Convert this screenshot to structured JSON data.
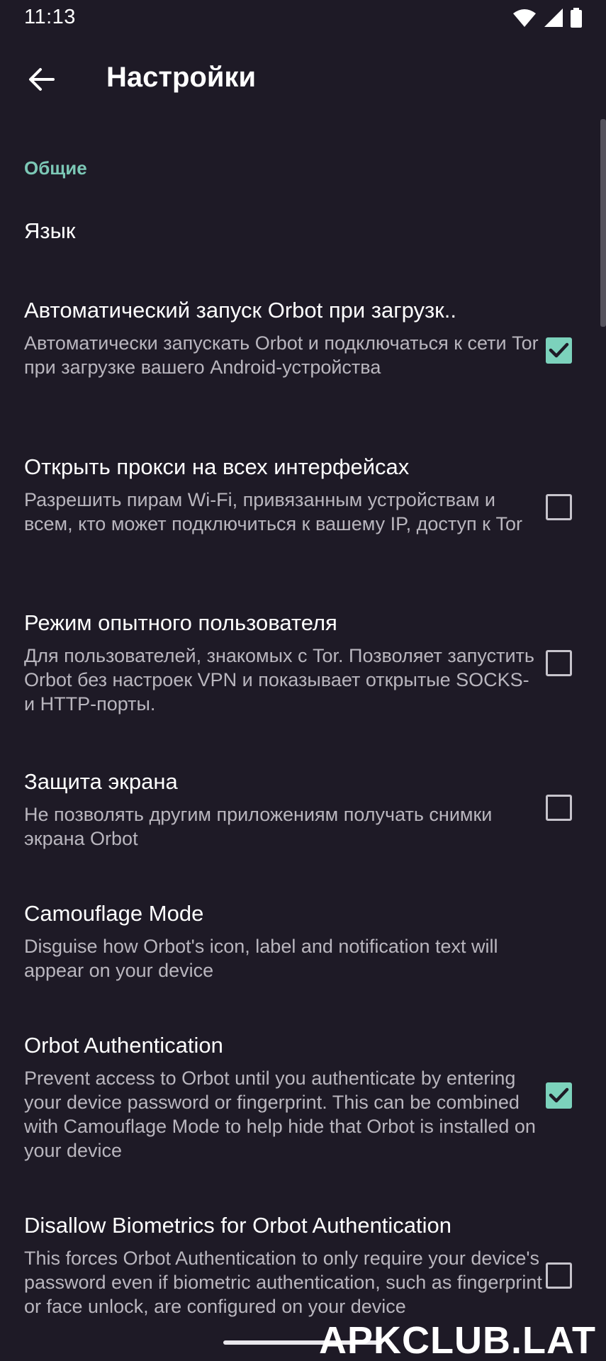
{
  "status_bar": {
    "time": "11:13",
    "icons": [
      "wifi-icon",
      "cellular-icon",
      "battery-icon"
    ]
  },
  "toolbar": {
    "title": "Настройки",
    "back_icon": "arrow-back-icon"
  },
  "section": {
    "title": "Общие"
  },
  "preferences": [
    {
      "title": "Язык"
    },
    {
      "title": "Автоматический запуск Orbot при загрузк..",
      "summary": "Автоматически запускать Orbot и подключаться к сети Tor при загрузке вашего Android-устройства",
      "checked": true
    },
    {
      "title": "Открыть прокси на всех интерфейсах",
      "summary": "Разрешить пирам Wi-Fi, привязанным устройствам и всем, кто может подключиться к вашему IP, доступ к Tor",
      "checked": false
    },
    {
      "title": "Режим опытного пользователя",
      "summary": "Для пользователей, знакомых с Tor. Позволяет запустить Orbot без настроек VPN и показывает открытые SOCKS- и HTTP-порты.",
      "checked": false
    },
    {
      "title": "Защита экрана",
      "summary": "Не позволять другим приложениям получать снимки экрана Orbot",
      "checked": false
    },
    {
      "title": "Camouflage Mode",
      "summary": "Disguise how Orbot's icon, label and notification text will appear on your device"
    },
    {
      "title": "Orbot Authentication",
      "summary": "Prevent access to Orbot until you authenticate by entering your device password or fingerprint. This can be combined with Camouflage Mode to help hide that Orbot is installed on your device",
      "checked": true
    },
    {
      "title": "Disallow Biometrics for Orbot Authentication",
      "summary": "This forces Orbot Authentication to only require your device's password even if biometric authentication, such as fingerprint or face unlock, are configured on your device",
      "checked": false
    }
  ],
  "watermark": "APKCLUB.LAT",
  "colors": {
    "background": "#1e1a26",
    "accent": "#7cd2bc",
    "category": "#7cc8b6",
    "summary_text": "#b9b6be"
  }
}
